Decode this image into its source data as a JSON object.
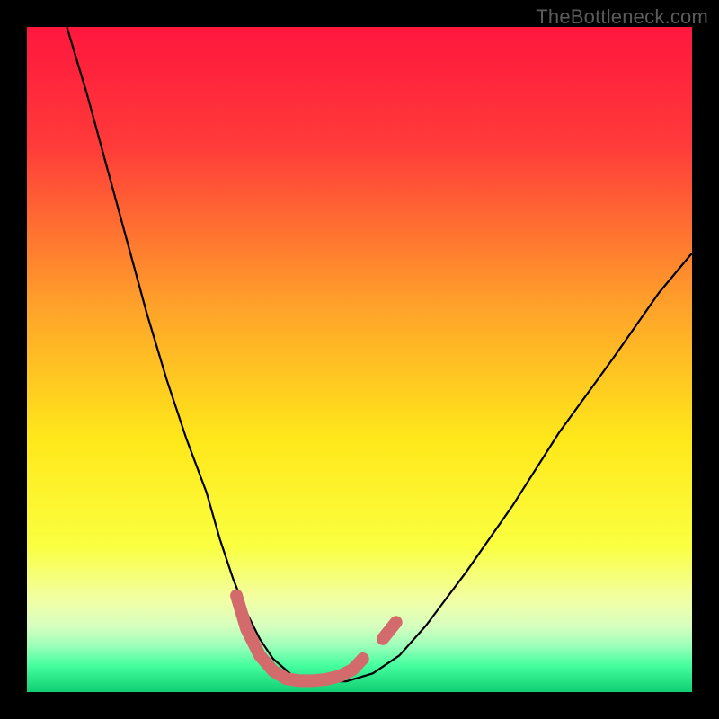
{
  "watermark": "TheBottleneck.com",
  "chart_data": {
    "type": "line",
    "title": "",
    "xlabel": "",
    "ylabel": "",
    "xlim": [
      0,
      100
    ],
    "ylim": [
      0,
      100
    ],
    "grid": false,
    "legend": false,
    "gradient_stops": [
      {
        "pct": 0,
        "color": "#ff173e"
      },
      {
        "pct": 18,
        "color": "#ff3b39"
      },
      {
        "pct": 42,
        "color": "#ffa22a"
      },
      {
        "pct": 62,
        "color": "#ffe81a"
      },
      {
        "pct": 78,
        "color": "#faff3f"
      },
      {
        "pct": 86,
        "color": "#f2ffa4"
      },
      {
        "pct": 90,
        "color": "#d8ffbf"
      },
      {
        "pct": 93,
        "color": "#9dffba"
      },
      {
        "pct": 96,
        "color": "#46ff9f"
      },
      {
        "pct": 100,
        "color": "#0fce72"
      }
    ],
    "series": [
      {
        "name": "bottleneck-curve",
        "color": "#000000",
        "width": 2.2,
        "x": [
          6,
          9,
          12,
          15,
          18,
          21,
          24,
          27,
          29,
          31,
          33,
          35,
          37,
          40,
          44,
          48,
          52,
          56,
          60,
          66,
          73,
          80,
          88,
          95,
          100
        ],
        "y": [
          100,
          90,
          79,
          68,
          57,
          47,
          38,
          30,
          23,
          17,
          12,
          8,
          5,
          2.4,
          1.6,
          1.6,
          2.8,
          5.5,
          10,
          18,
          28,
          39,
          50,
          60,
          66
        ]
      },
      {
        "name": "valley-marker",
        "color": "#d36a6c",
        "width": 14,
        "linecap": "round",
        "x": [
          31.5,
          33,
          35,
          37,
          39,
          41,
          43,
          45,
          47,
          49,
          50.5
        ],
        "y": [
          14.5,
          9.5,
          5.5,
          3.2,
          2.0,
          1.7,
          1.7,
          1.9,
          2.4,
          3.4,
          5.0
        ]
      },
      {
        "name": "valley-marker-right-dot",
        "color": "#d36a6c",
        "width": 14,
        "linecap": "round",
        "x": [
          53.5,
          55.5
        ],
        "y": [
          8.0,
          10.5
        ]
      }
    ]
  }
}
